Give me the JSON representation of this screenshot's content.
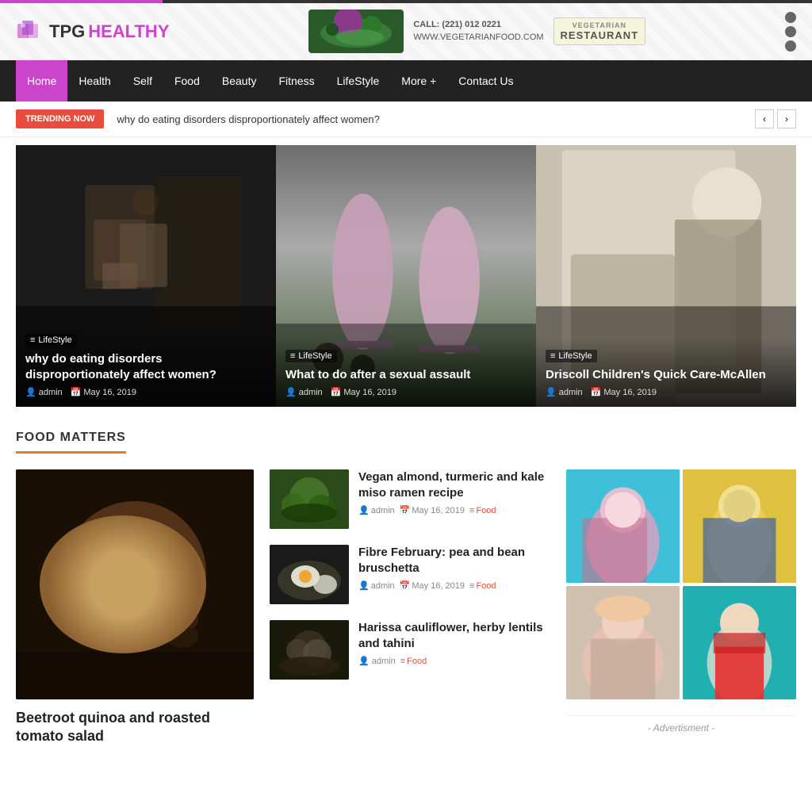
{
  "site": {
    "logo_prefix": "TPG",
    "logo_suffix": "HEALTHY",
    "call_label": "CALL: (221) 012 0221",
    "website": "WWW.VEGETARIANFOOD.COM",
    "restaurant_sub": "VEGETARIAN",
    "restaurant_label": "RESTAURANT"
  },
  "nav": {
    "items": [
      {
        "label": "Home",
        "active": true
      },
      {
        "label": "Health",
        "active": false
      },
      {
        "label": "Self",
        "active": false
      },
      {
        "label": "Food",
        "active": false
      },
      {
        "label": "Beauty",
        "active": false
      },
      {
        "label": "Fitness",
        "active": false
      },
      {
        "label": "LifeStyle",
        "active": false
      },
      {
        "label": "More +",
        "active": false
      },
      {
        "label": "Contact Us",
        "active": false
      }
    ]
  },
  "trending": {
    "badge": "TRENDING NOW",
    "text": "why do eating disorders disproportionately affect women?"
  },
  "hero_cards": [
    {
      "category": "LifeStyle",
      "title": "why do eating disorders disproportionately affect women?",
      "author": "admin",
      "date": "May 16, 2019",
      "img_class": "img-dark-kitchen"
    },
    {
      "category": "LifeStyle",
      "title": "What to do after a sexual assault",
      "author": "admin",
      "date": "May 16, 2019",
      "img_class": "img-smoothie"
    },
    {
      "category": "LifeStyle",
      "title": "Driscoll Children's Quick Care-McAllen",
      "author": "admin",
      "date": "May 16, 2019",
      "img_class": "img-bedroom"
    }
  ],
  "food_section": {
    "title": "FOOD MATTERS",
    "large_card": {
      "title": "Beetroot quinoa and roasted tomato salad"
    },
    "small_cards": [
      {
        "title": "Vegan almond, turmeric and kale miso ramen recipe",
        "author": "admin",
        "date": "May 16, 2019",
        "category": "Food",
        "img_class": "img-green-food"
      },
      {
        "title": "Fibre February: pea and bean bruschetta",
        "author": "admin",
        "date": "May 16, 2019",
        "category": "Food",
        "img_class": "img-egg-food"
      },
      {
        "title": "Harissa cauliflower, herby lentils and tahini",
        "author": "admin",
        "date": "",
        "category": "Food",
        "img_class": "img-cauliflower"
      }
    ]
  },
  "advertisement": {
    "label": "- Advertisment -"
  }
}
